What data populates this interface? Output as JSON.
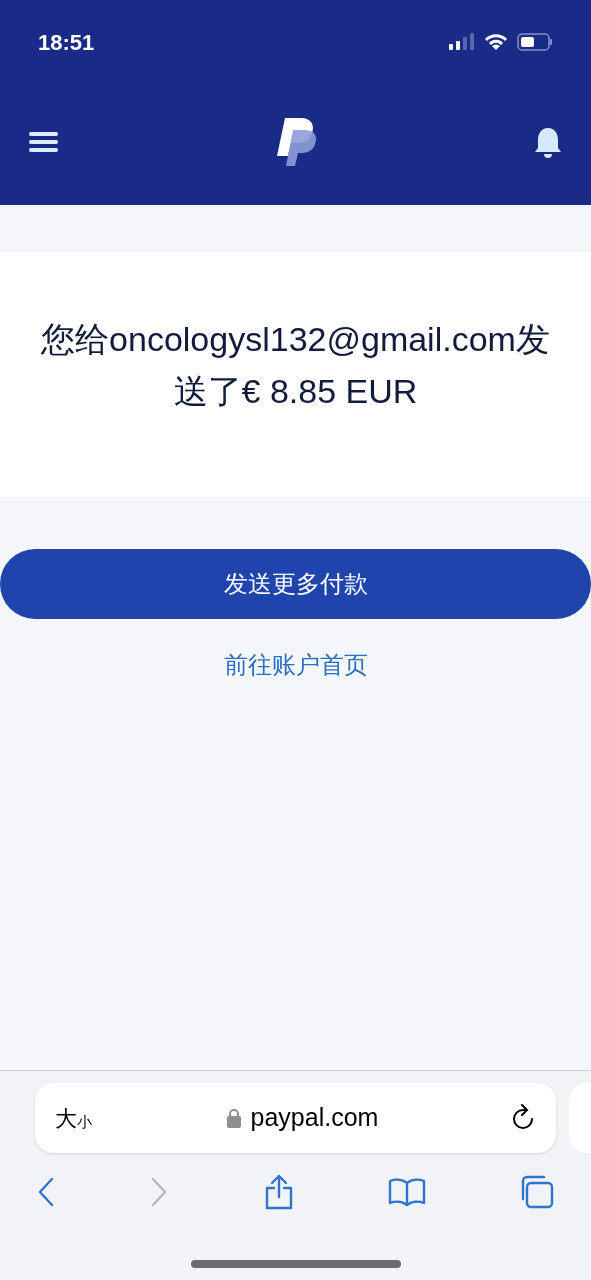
{
  "status_bar": {
    "time": "18:51"
  },
  "message": "您给oncologysl132@gmail.com发送了€ 8.85 EUR",
  "primary_button": "发送更多付款",
  "link": "前往账户首页",
  "browser": {
    "text_size": [
      "大",
      "小"
    ],
    "url": "paypal.com",
    "toolbar": [
      {
        "kind": "back",
        "disabled": false
      },
      {
        "kind": "forward",
        "disabled": true
      },
      {
        "kind": "share",
        "disabled": false
      },
      {
        "kind": "bookmarks",
        "disabled": false
      },
      {
        "kind": "tabs",
        "disabled": false
      }
    ]
  }
}
